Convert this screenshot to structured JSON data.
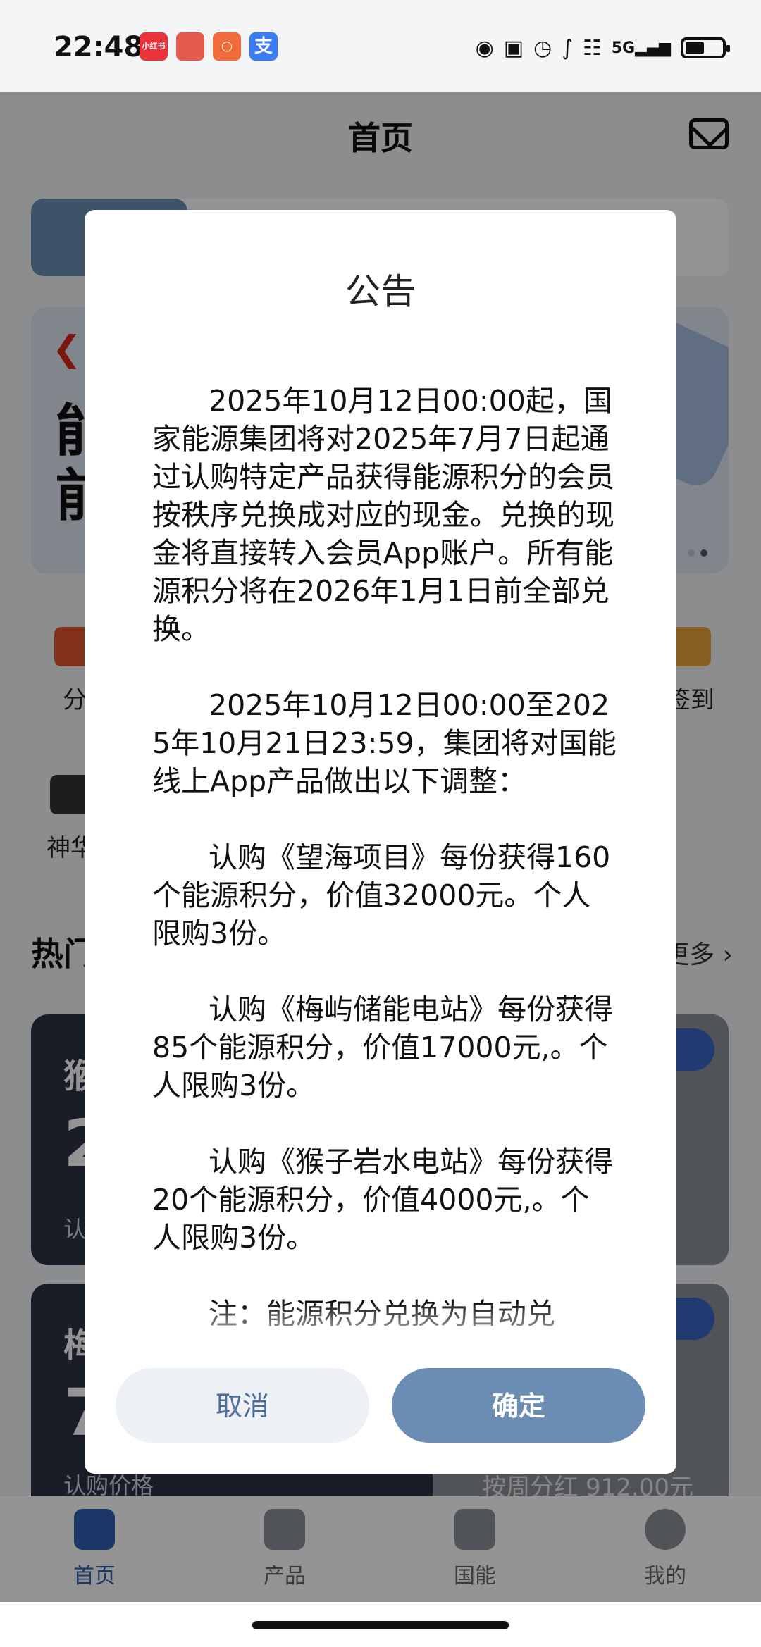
{
  "status_bar": {
    "time": "22:48",
    "apps": [
      {
        "name": "xiaohongshu-icon",
        "label": "小红书",
        "color": "#e8333a"
      },
      {
        "name": "game-app-icon",
        "label": "",
        "color": "#e45b4b"
      },
      {
        "name": "meituan-app-icon",
        "label": "",
        "color": "#f26b3a"
      },
      {
        "name": "alipay-icon",
        "label": "支",
        "color": "#3b7cf5"
      }
    ],
    "network": "5G"
  },
  "header": {
    "title": "首页"
  },
  "background": {
    "banner_text": "能\n前",
    "grid": [
      {
        "label": "分"
      },
      {
        "label": "签到"
      },
      {
        "label": "神华"
      }
    ],
    "section_title": "热门",
    "more_label": "更多",
    "cards": [
      {
        "name": "猴",
        "big": "2",
        "sub": "认"
      },
      {
        "name": "梅",
        "big": "7",
        "sub": "认购价格",
        "right": "按周分红 912.00元"
      }
    ]
  },
  "bottom_nav": [
    {
      "label": "首页",
      "icon": "home-icon",
      "active": true
    },
    {
      "label": "产品",
      "icon": "chart-icon",
      "active": false
    },
    {
      "label": "国能",
      "icon": "guoneng-logo-icon",
      "active": false
    },
    {
      "label": "我的",
      "icon": "profile-icon",
      "active": false
    }
  ],
  "dialog": {
    "title": "公告",
    "paragraphs": [
      "2025年10月12日00:00起，国家能源集团将对2025年7月7日起通过认购特定产品获得能源积分的会员按秩序兑换成对应的现金。兑换的现金将直接转入会员App账户。所有能源积分将在2026年1月1日前全部兑换。",
      "2025年10月12日00:00至2025年10月21日23:59，集团将对国能线上App产品做出以下调整：",
      "认购《望海项目》每份获得160个能源积分，价值32000元。个人限购3份。",
      "认购《梅屿储能电站》每份获得85个能源积分，价值17000元,。个人限购3份。",
      "认购《猴子岩水电站》每份获得20个能源积分，价值4000元,。个人限购3份。",
      "注：能源积分兑换为自动兑"
    ],
    "cancel_label": "取消",
    "confirm_label": "确定"
  }
}
